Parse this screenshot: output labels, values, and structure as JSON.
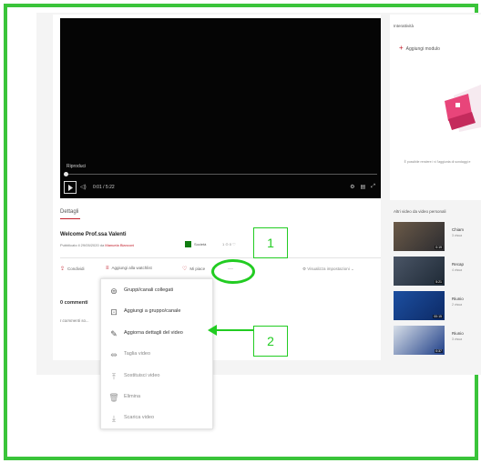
{
  "video": {
    "play_label": "Riproduci",
    "time": "0:01 / 5:22",
    "controls": [
      "⚙",
      "▤",
      "⤢"
    ]
  },
  "details": {
    "tab": "Dettagli",
    "title": "Welcome Prof.ssa Valenti",
    "published_prefix": "Pubblicato il 29/05/2020 da",
    "author": "Manuela Bianconi",
    "share_chip": "Società",
    "counts": "1 ⊙  0 ♡"
  },
  "actions": {
    "share": "Condividi",
    "add_to_watchlist": "Aggiungi alla watchlist",
    "like": "Mi piace",
    "more": "···",
    "view_settings": "Visualizza impostazioni"
  },
  "comments": {
    "title": "0 commenti",
    "empty": "I commenti so..."
  },
  "menu": {
    "items": [
      {
        "label": "Gruppi/canali collegati",
        "icon": "⊜"
      },
      {
        "label": "Aggiungi a gruppo/canale",
        "icon": "⊡"
      },
      {
        "label": "Aggiorna dettagli del video",
        "icon": "✎"
      },
      {
        "label": "Taglia video",
        "icon": "⇹"
      },
      {
        "label": "Sostituisci video",
        "icon": "⤒"
      },
      {
        "label": "Elimina",
        "icon": "🗑"
      },
      {
        "label": "Scarica video",
        "icon": "⤓"
      }
    ]
  },
  "right_panel": {
    "interactivity_tab": "Interattività",
    "add_module": "Aggiungi modulo",
    "note": "È possibile rendere i vi l'aggiunta di sondaggi e",
    "other_videos_title": "Altri video da video personali"
  },
  "related_videos": [
    {
      "title": "Chiam",
      "sub": "3 visua",
      "duration": "0:19"
    },
    {
      "title": "Recap",
      "sub": "4 visua",
      "duration": "5:21"
    },
    {
      "title": "Riunio",
      "sub": "2 visua",
      "duration": "00:15"
    },
    {
      "title": "Riunio",
      "sub": "3 visua",
      "duration": "0:37"
    }
  ],
  "annotations": {
    "callout_1": "1",
    "callout_2": "2",
    "color": "#22cc22"
  },
  "colors": {
    "accent": "#c3212d",
    "frame": "#3ac43a",
    "share_green": "#107c10"
  }
}
